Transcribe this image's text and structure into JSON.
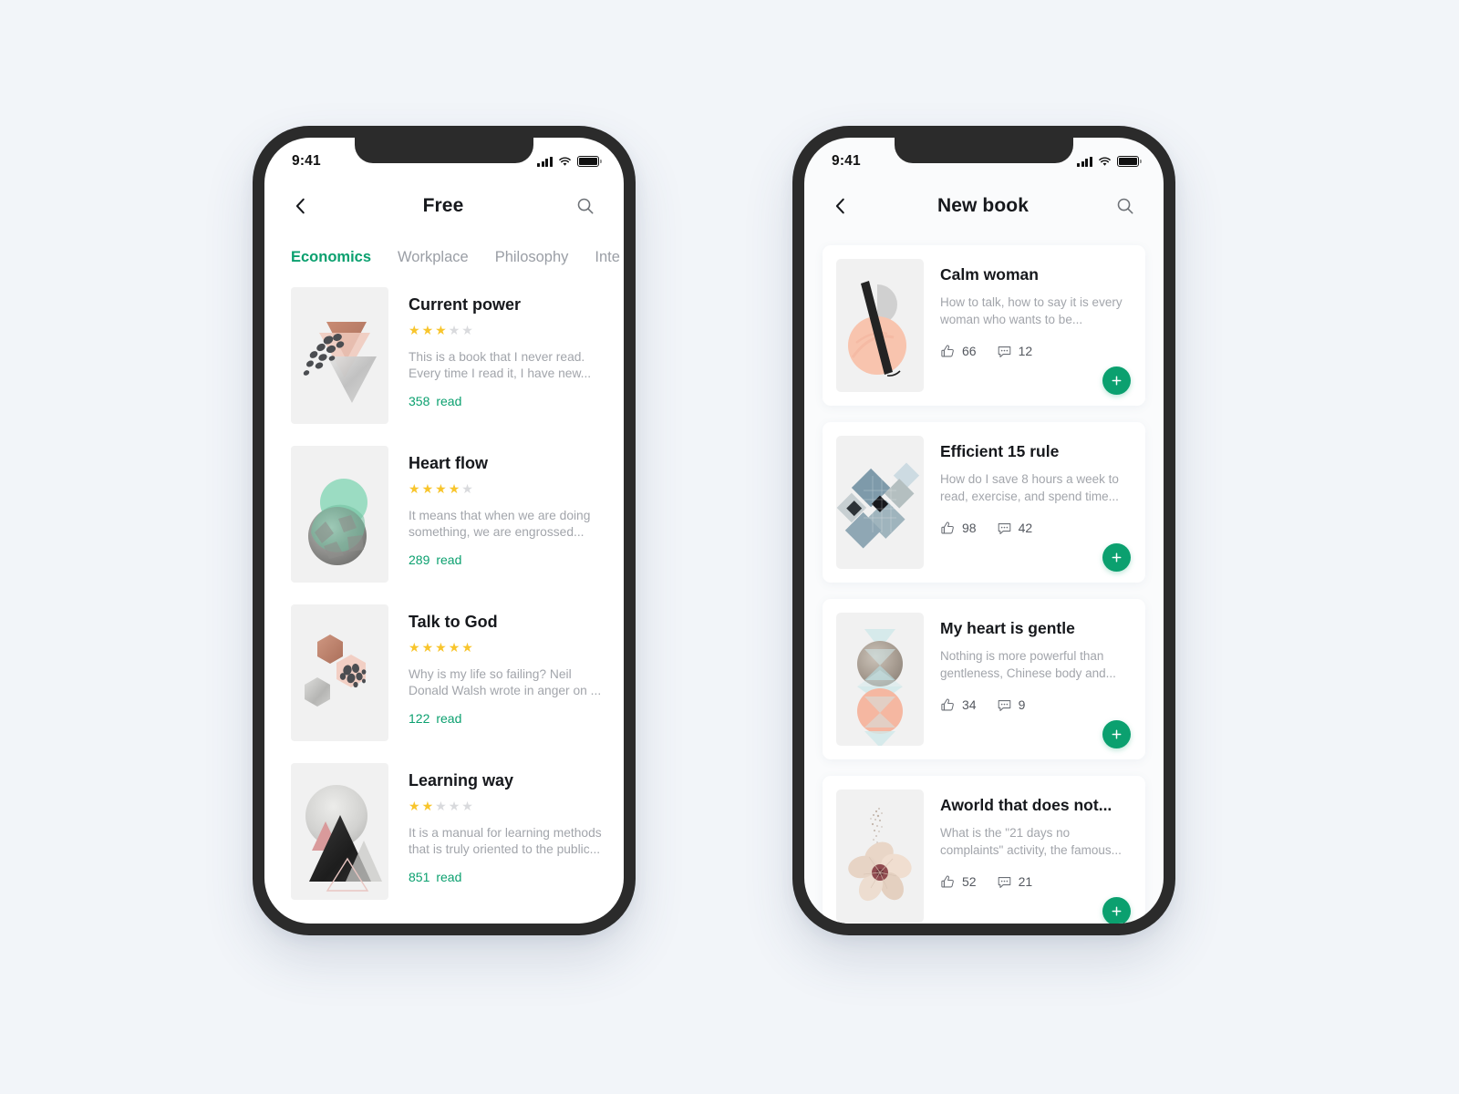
{
  "background_color": "#f2f5f9",
  "accent_color": "#0ba06f",
  "star_color": "#f8c52c",
  "status_bar": {
    "time": "9:41",
    "icons": [
      "cellular-signal-icon",
      "wifi-icon",
      "battery-icon"
    ]
  },
  "left_phone": {
    "nav": {
      "back_label": "‹",
      "title": "Free",
      "search_label": "search-icon"
    },
    "tabs": [
      {
        "label": "Economics",
        "active": true
      },
      {
        "label": "Workplace",
        "active": false
      },
      {
        "label": "Philosophy",
        "active": false
      },
      {
        "label": "Inte",
        "active": false
      }
    ],
    "read_suffix": "read",
    "books": [
      {
        "title": "Current power",
        "rating": 3,
        "max_rating": 5,
        "description": "This is a book that I never read. Every time I read it, I have new...",
        "reads": "358",
        "cover": "triangles-copper-marble"
      },
      {
        "title": "Heart flow",
        "rating": 4,
        "max_rating": 5,
        "description": "It means that when we are doing something, we are engrossed...",
        "reads": "289",
        "cover": "circles-mint-stone"
      },
      {
        "title": "Talk to God",
        "rating": 5,
        "max_rating": 5,
        "description": "Why is my life so failing? Neil Donald Walsh wrote in anger on ...",
        "reads": "122",
        "cover": "hexagons-copper-blush"
      },
      {
        "title": "Learning way",
        "rating": 2,
        "max_rating": 5,
        "description": "It is a manual for learning methods that is truly oriented to the public...",
        "reads": "851",
        "cover": "mountains-circle"
      }
    ]
  },
  "right_phone": {
    "nav": {
      "back_label": "‹",
      "title": "New book",
      "search_label": "search-icon"
    },
    "cards": [
      {
        "title": "Calm woman",
        "description": "How to talk, how to say it is every woman who wants to be...",
        "likes": "66",
        "comments": "12",
        "add_label": "+",
        "cover": "peach-circle-black-bar"
      },
      {
        "title": "Efficient 15 rule",
        "description": "How do I save 8 hours a week to read, exercise, and spend time...",
        "likes": "98",
        "comments": "42",
        "add_label": "+",
        "cover": "blue-diamonds"
      },
      {
        "title": "My heart is gentle",
        "description": "Nothing is more powerful than gentleness, Chinese body and...",
        "likes": "34",
        "comments": "9",
        "add_label": "+",
        "cover": "circles-hourglass"
      },
      {
        "title": "Aworld that does not...",
        "description": "What is the \"21 days no complaints\" activity, the famous...",
        "likes": "52",
        "comments": "21",
        "add_label": "+",
        "cover": "hibiscus-flower"
      }
    ]
  }
}
